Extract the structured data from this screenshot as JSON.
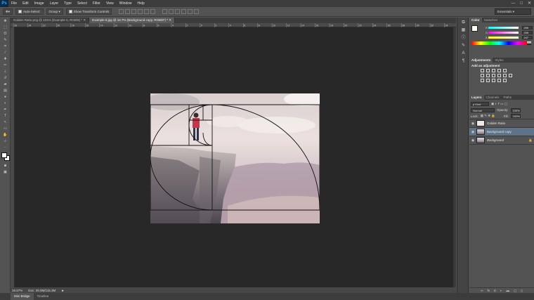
{
  "app": {
    "logo": "Ps",
    "menu": [
      "File",
      "Edit",
      "Image",
      "Layer",
      "Type",
      "Select",
      "Filter",
      "View",
      "Window",
      "Help"
    ],
    "window_controls": [
      "—",
      "□",
      "✕"
    ]
  },
  "options_bar": {
    "auto_select_label": "Auto-Select:",
    "auto_select_value": "Group",
    "show_transform_label": "Show Transform Controls",
    "workspace": "Essentials"
  },
  "tabs": [
    {
      "label": "Golden Ratio.png @ 101% (Example 5, RGB/8) *",
      "close": "✕"
    },
    {
      "label": "Example 5.jpg @ 16.7% (Background copy, RGB/8*) *",
      "close": "✕"
    }
  ],
  "ruler_ticks": [
    "26",
    "24",
    "22",
    "20",
    "18",
    "16",
    "14",
    "12",
    "10",
    "8",
    "6",
    "4",
    "2",
    "0",
    "2",
    "4",
    "6",
    "8",
    "10",
    "12",
    "14",
    "16",
    "18",
    "20",
    "22",
    "24",
    "26",
    "28",
    "30",
    "32",
    "34"
  ],
  "status": {
    "zoom": "16.67%",
    "doc": "Doc: 25.0M/115.3M",
    "arrow": "►"
  },
  "bottom_tabs": [
    "Mini Bridge",
    "Timeline"
  ],
  "color_panel": {
    "tabs": [
      "Color",
      "Swatches"
    ],
    "r": "255",
    "g": "255",
    "b": "247",
    "r_label": "R",
    "g_label": "G",
    "b_label": "B"
  },
  "adjustments_panel": {
    "tabs": [
      "Adjustments",
      "Styles"
    ],
    "heading": "Add an adjustment"
  },
  "layers_panel": {
    "tabs": [
      "Layers",
      "Channels",
      "Paths"
    ],
    "kind_filter": "ρ Kind",
    "blend_mode": "Normal",
    "opacity_label": "Opacity:",
    "opacity_value": "100%",
    "lock_label": "Lock:",
    "fill_label": "Fill:",
    "fill_value": "100%",
    "layers": [
      {
        "name": "Golden Ratio",
        "selected": false
      },
      {
        "name": "Background copy",
        "selected": true
      },
      {
        "name": "Background",
        "selected": false,
        "locked": true
      }
    ]
  },
  "colors": {
    "accent_selection": "#5f7388",
    "canvas_bg": "#282828",
    "panel_bg": "#535353"
  }
}
